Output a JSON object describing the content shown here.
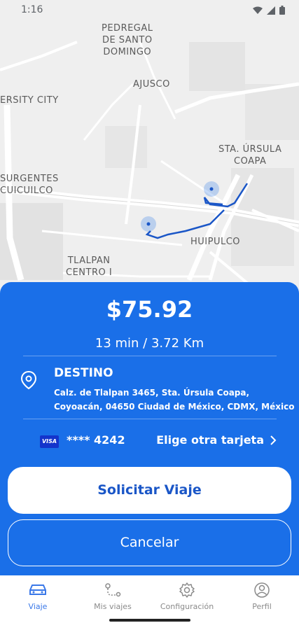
{
  "status_bar": {
    "time": "1:16"
  },
  "map": {
    "labels": {
      "pedregal": "PEDREGAL\nDE SANTO\nDOMINGO",
      "ajusco": "AJUSCO",
      "ersity_city": "ERSITY CITY",
      "sta_ursula": "STA. ÚRSULA\nCOAPA",
      "surgentes": "SURGENTES\nCUICUILCO",
      "huipulco": "HUIPULCO",
      "tlalpan": "TLALPAN\nCENTRO I"
    },
    "route_color": "#1a56c7"
  },
  "trip": {
    "price": "$75.92",
    "eta": "13 min / 3.72 Km",
    "destination_title": "DESTINO",
    "destination_address": "Calz. de Tlalpan 3465, Sta. Úrsula Coapa, Coyoacán, 04650 Ciudad de México, CDMX, México"
  },
  "payment": {
    "card_brand": "VISA",
    "card_number": "**** 4242",
    "change_card": "Elige otra tarjeta"
  },
  "buttons": {
    "request": "Solicitar Viaje",
    "cancel": "Cancelar"
  },
  "nav": {
    "items": [
      {
        "label": "Viaje",
        "icon": "car-icon",
        "active": true
      },
      {
        "label": "Mis viajes",
        "icon": "route-icon",
        "active": false
      },
      {
        "label": "Configuración",
        "icon": "gear-icon",
        "active": false
      },
      {
        "label": "Perfil",
        "icon": "user-icon",
        "active": false
      }
    ]
  },
  "colors": {
    "primary": "#1a6fe8",
    "active_nav": "#3a78e8"
  }
}
